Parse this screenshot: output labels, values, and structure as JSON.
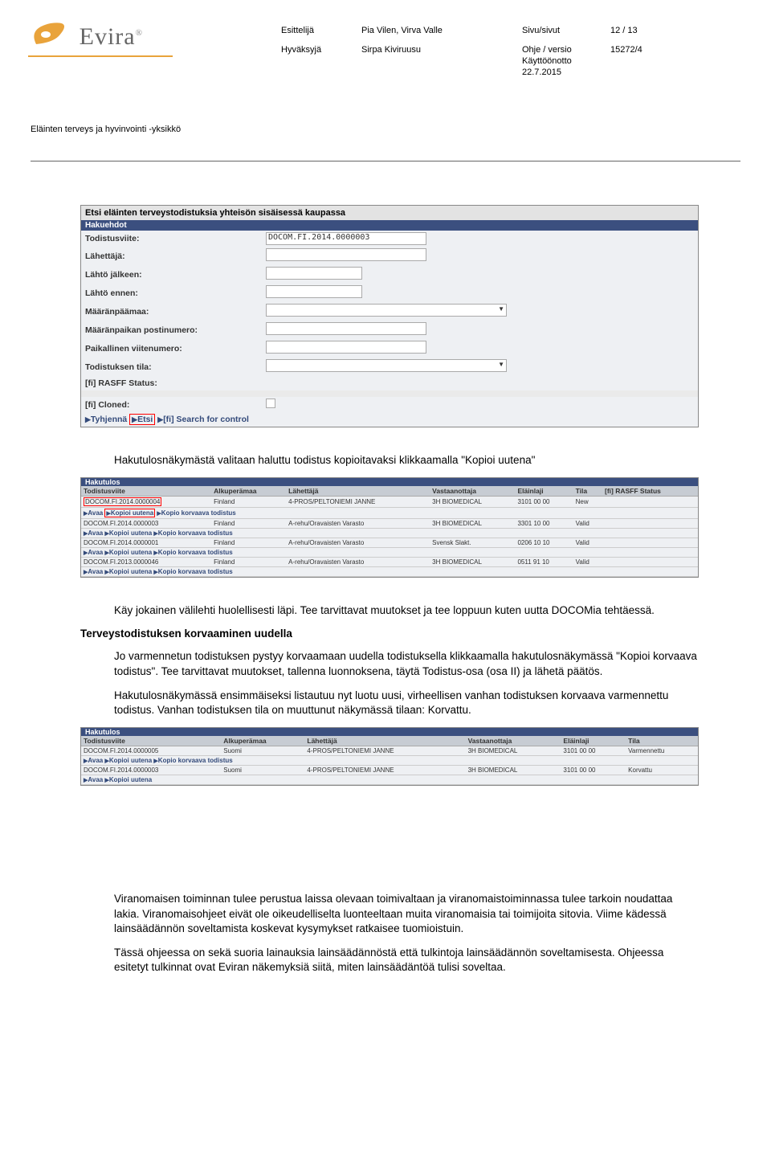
{
  "header": {
    "brand": "Evira",
    "col_presenter_label": "Esittelijä",
    "col_presenter_value": "Pia Vilen, Virva Valle",
    "col_page_label": "Sivu/sivut",
    "col_page_value": "12 / 13",
    "col_approver_label": "Hyväksyjä",
    "col_approver_value": "Sirpa Kiviruusu",
    "col_doc_label1": "Ohje / versio",
    "col_doc_value1": "15272/4",
    "col_doc_label2": "Käyttöönotto",
    "col_doc_label3": "22.7.2015",
    "subheader": "Eläinten terveys ja hyvinvointi -yksikkö"
  },
  "search_form": {
    "title": "Etsi eläinten terveystodistuksia yhteisön sisäisessä kaupassa",
    "section": "Hakuehdot",
    "fields": {
      "todistusviite": "Todistusviite:",
      "todistusviite_value": "DOCOM.FI.2014.0000003",
      "lahettaja": "Lähettäjä:",
      "lahto_jalkeen": "Lähtö jälkeen:",
      "lahto_ennen": "Lähtö ennen:",
      "maaranpaamaa": "Määränpäämaa:",
      "maaranpaikan_pn": "Määränpaikan postinumero:",
      "paikallinen_vn": "Paikallinen viitenumero:",
      "todistuksen_tila": "Todistuksen tila:",
      "rasff_status": "[fi] RASFF Status:",
      "cloned": "[fi] Cloned:"
    },
    "footer": {
      "tyhjenna": "Tyhjennä",
      "etsi": "Etsi",
      "search_control": "[fi] Search for control"
    }
  },
  "para1": "Hakutulosnäkymästä valitaan haluttu todistus kopioitavaksi klikkaamalla \"Kopioi uutena\"",
  "results1": {
    "section": "Hakutulos",
    "columns": [
      "Todistusviite",
      "Alkuperämaa",
      "Lähettäjä",
      "Vastaanottaja",
      "Eläinlaji",
      "Tila",
      "[fi] RASFF Status"
    ],
    "rows": [
      {
        "ref": "DOCOM.FI.2014.0000004",
        "country": "Finland",
        "sender": "4-PROS/PELTONIEMI JANNE",
        "receiver": "3H BIOMEDICAL",
        "species": "3101 00 00",
        "status": "New",
        "rasff": ""
      },
      {
        "ref": "DOCOM.FI.2014.0000003",
        "country": "Finland",
        "sender": "A-rehu/Oravaisten Varasto",
        "receiver": "3H BIOMEDICAL",
        "species": "3301 10 00",
        "status": "Valid",
        "rasff": ""
      },
      {
        "ref": "DOCOM.FI.2014.0000001",
        "country": "Finland",
        "sender": "A-rehu/Oravaisten Varasto",
        "receiver": "Svensk Slakt.",
        "species": "0206 10 10",
        "status": "Valid",
        "rasff": ""
      },
      {
        "ref": "DOCOM.FI.2013.0000046",
        "country": "Finland",
        "sender": "A-rehu/Oravaisten Varasto",
        "receiver": "3H BIOMEDICAL",
        "species": "0511 91 10",
        "status": "Valid",
        "rasff": ""
      }
    ],
    "actions": {
      "avaa": "Avaa",
      "kopioi_uutena": "Kopioi uutena",
      "kopio_korvaava": "Kopio korvaava todistus"
    }
  },
  "para2": "Käy jokainen välilehti huolellisesti läpi. Tee tarvittavat muutokset ja tee loppuun kuten uutta DOCOMia tehtäessä.",
  "heading3": "Terveystodistuksen korvaaminen uudella",
  "para3a": "Jo varmennetun todistuksen pystyy korvaamaan uudella todistuksella klikkaamalla hakutulosnäkymässä \"Kopioi korvaava todistus\". Tee tarvittavat muutokset, tallenna luonnoksena, täytä Todistus-osa (osa II) ja lähetä päätös.",
  "para3b": "Hakutulosnäkymässä ensimmäiseksi listautuu nyt luotu uusi, virheellisen vanhan todistuksen korvaava varmennettu todistus. Vanhan todistuksen tila on muuttunut näkymässä tilaan: Korvattu.",
  "results2": {
    "section": "Hakutulos",
    "columns": [
      "Todistusviite",
      "Alkuperämaa",
      "Lähettäjä",
      "Vastaanottaja",
      "Eläinlaji",
      "Tila"
    ],
    "rows": [
      {
        "ref": "DOCOM.FI.2014.0000005",
        "country": "Suomi",
        "sender": "4-PROS/PELTONIEMI JANNE",
        "receiver": "3H BIOMEDICAL",
        "species": "3101 00 00",
        "status": "Varmennettu"
      },
      {
        "ref": "DOCOM.FI.2014.0000003",
        "country": "Suomi",
        "sender": "4-PROS/PELTONIEMI JANNE",
        "receiver": "3H BIOMEDICAL",
        "species": "3101 00 00",
        "status": "Korvattu"
      }
    ],
    "actions": {
      "avaa": "Avaa",
      "kopioi_uutena": "Kopioi uutena",
      "kopio_korvaava": "Kopio korvaava todistus"
    }
  },
  "para4": "Viranomaisen toiminnan tulee perustua laissa olevaan toimivaltaan ja viranomaistoiminnassa tulee tarkoin noudattaa lakia. Viranomaisohjeet eivät ole oikeudelliselta luonteeltaan muita viranomaisia tai toimijoita sitovia. Viime kädessä lainsäädännön soveltamista koskevat kysymykset ratkaisee tuomioistuin.",
  "para5": "Tässä ohjeessa on sekä suoria lainauksia lainsäädännöstä että tulkintoja lainsäädännön soveltamisesta. Ohjeessa esitetyt tulkinnat ovat Eviran näkemyksiä siitä, miten lainsäädäntöä tulisi soveltaa."
}
